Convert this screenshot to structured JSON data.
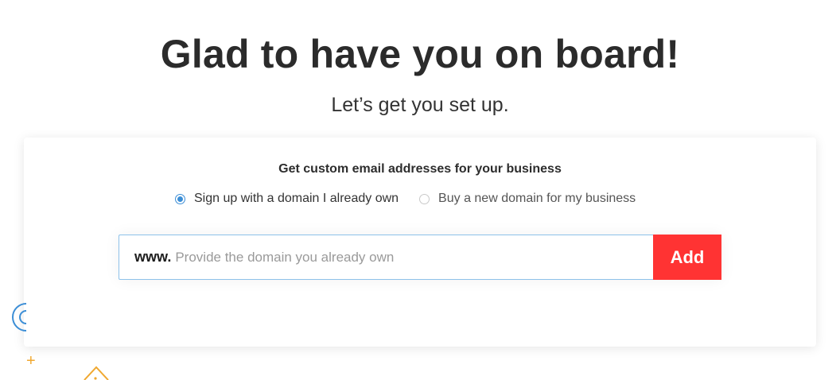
{
  "hero": {
    "title": "Glad to have you on board!",
    "subtitle": "Let’s get you set up."
  },
  "card": {
    "title": "Get custom email addresses for your business",
    "options": [
      {
        "label": "Sign up with a domain I already own",
        "selected": true
      },
      {
        "label": "Buy a new domain for my business",
        "selected": false
      }
    ],
    "domain": {
      "prefix": "www.",
      "value": "",
      "placeholder": "Provide the domain you already own"
    },
    "add_label": "Add"
  },
  "colors": {
    "accent_red": "#ff3333",
    "radio_blue": "#3c8ed6",
    "input_border": "#8ec2ea",
    "deco_blue": "#3c8ed6",
    "deco_orange": "#f0a830"
  },
  "icons": {
    "decor_1": "circle-outline-icon",
    "decor_2": "plus-icon",
    "decor_3": "house-outline-icon"
  }
}
